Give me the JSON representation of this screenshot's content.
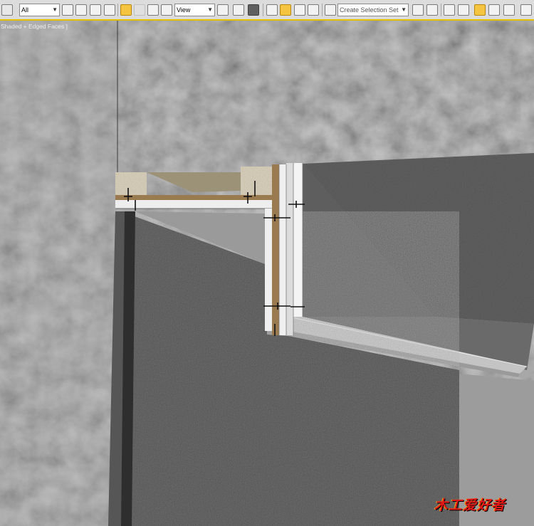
{
  "toolbar": {
    "filter": {
      "value": "All"
    },
    "reference_coord": {
      "value": "View"
    },
    "named_selection": {
      "placeholder": "Create Selection Set"
    }
  },
  "viewport": {
    "label": "Shaded + Edged Faces ]"
  },
  "icons": [
    "select-object-icon",
    "select-by-name-icon",
    "rectangular-region-icon",
    "window-crossing-icon",
    "select-and-move-icon",
    "select-and-rotate-icon",
    "select-and-scale-icon",
    "use-pivot-center-icon",
    "select-and-manipulate-icon",
    "keyboard-shortcut-icon",
    "snaps-toggle-icon",
    "angle-snap-icon",
    "percent-snap-icon",
    "spinner-snap-icon",
    "edit-named-selection-icon",
    "mirror-icon",
    "align-icon",
    "layer-manager-icon",
    "graphite-ribbon-icon",
    "curve-editor-icon",
    "schematic-view-icon",
    "material-editor-icon"
  ],
  "watermark": "木工爱好者",
  "colors": {
    "accent": "#e6c100",
    "active_tool": "#f5c542"
  }
}
